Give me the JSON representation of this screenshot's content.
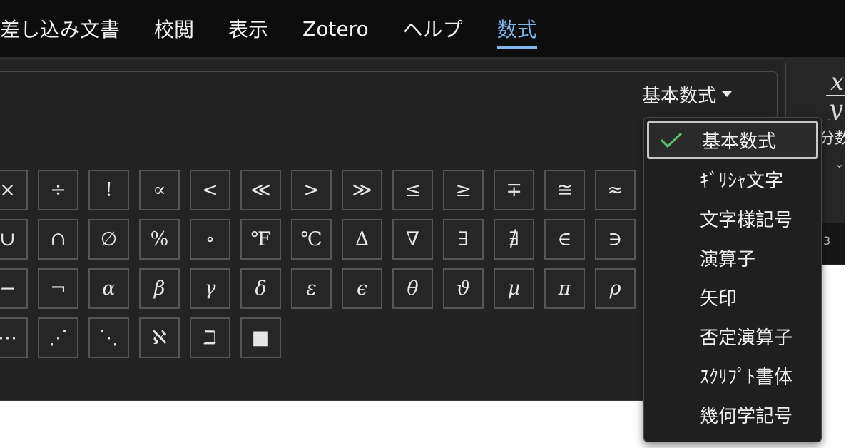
{
  "menu": {
    "tabs": [
      {
        "label": "差し込み文書"
      },
      {
        "label": "校閲"
      },
      {
        "label": "表示"
      },
      {
        "label": "Zotero"
      },
      {
        "label": "ヘルプ"
      },
      {
        "label": "数式",
        "active": true
      }
    ]
  },
  "gallery": {
    "dropdown_label": "基本数式"
  },
  "fraction_group": {
    "label": "分数",
    "strip_text": "3"
  },
  "symbols": {
    "rows": [
      [
        "×",
        "÷",
        "!",
        "∝",
        "<",
        "≪",
        ">",
        "≫",
        "≤",
        "≥",
        "∓",
        "≅",
        "≈"
      ],
      [
        "∪",
        "∩",
        "∅",
        "%",
        "∘",
        "℉",
        "℃",
        "∆",
        "∇",
        "∃",
        "∄",
        "∈",
        "∋"
      ],
      [
        "−",
        "¬",
        "α",
        "β",
        "γ",
        "δ",
        "ε",
        "ϵ",
        "θ",
        "ϑ",
        "μ",
        "π",
        "ρ"
      ],
      [
        "⋯",
        "⋰",
        "⋱",
        "ℵ",
        "ℶ",
        "■"
      ]
    ]
  },
  "dropdown": {
    "items": [
      {
        "label": "基本数式",
        "selected": true
      },
      {
        "label": "ｷﾞﾘｼｬ文字"
      },
      {
        "label": "文字様記号"
      },
      {
        "label": "演算子"
      },
      {
        "label": "矢印"
      },
      {
        "label": "否定演算子"
      },
      {
        "label": "ｽｸﾘﾌﾟﾄ書体"
      },
      {
        "label": "幾何学記号"
      }
    ],
    "check_color": "#5cc26f"
  },
  "colors": {
    "accent": "#7fb6ef",
    "background": "#232323",
    "menubar": "#0d0d0d"
  }
}
